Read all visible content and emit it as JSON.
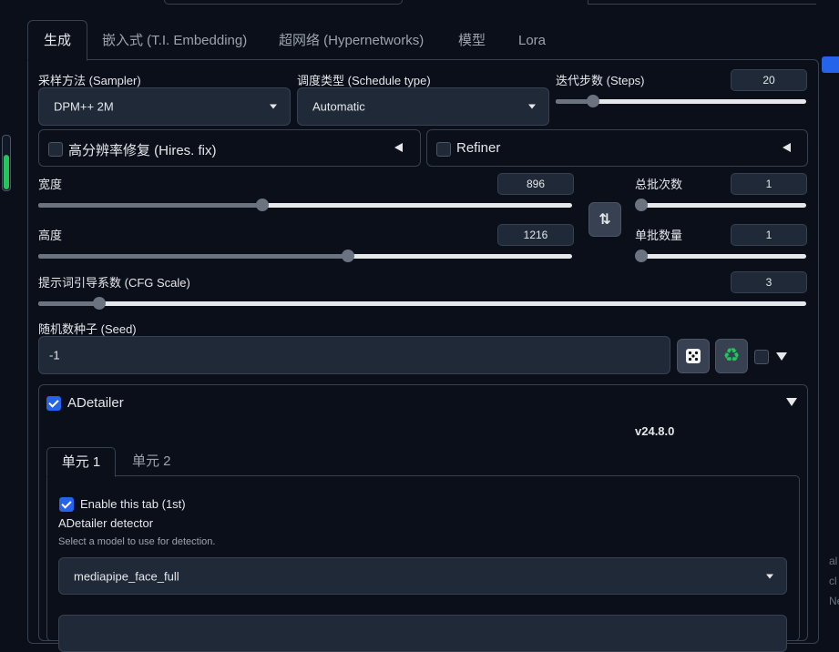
{
  "tabs": [
    "生成",
    "嵌入式 (T.I. Embedding)",
    "超网络 (Hypernetworks)",
    "模型",
    "Lora"
  ],
  "sampler": {
    "label": "采样方法 (Sampler)",
    "value": "DPM++ 2M"
  },
  "schedule": {
    "label": "调度类型 (Schedule type)",
    "value": "Automatic"
  },
  "steps": {
    "label": "迭代步数 (Steps)",
    "value": "20",
    "fraction": 0.15
  },
  "hires": {
    "label": "高分辨率修复 (Hires. fix)"
  },
  "refiner": {
    "label": "Refiner"
  },
  "width": {
    "label": "宽度",
    "value": "896",
    "fraction": 0.42
  },
  "height": {
    "label": "高度",
    "value": "1216",
    "fraction": 0.58
  },
  "batch_count": {
    "label": "总批次数",
    "value": "1",
    "fraction": 0.0
  },
  "batch_size": {
    "label": "单批数量",
    "value": "1",
    "fraction": 0.0
  },
  "cfg": {
    "label": "提示词引导系数 (CFG Scale)",
    "value": "3",
    "fraction": 0.08
  },
  "seed": {
    "label": "随机数种子 (Seed)",
    "value": "-1"
  },
  "swap_icon": "⇅",
  "dice_icon": "dice-icon",
  "recycle_icon": "♻",
  "adetailer": {
    "title": "ADetailer",
    "version": "v24.8.0",
    "tabs": [
      "单元 1",
      "单元 2"
    ],
    "enable_label": "Enable this tab (1st)",
    "detector_label": "ADetailer detector",
    "detector_hint": "Select a model to use for detection.",
    "detector_value": "mediapipe_face_full"
  },
  "side_text": [
    "al",
    "cl",
    "Ne"
  ],
  "colors": {
    "accent": "#2563eb",
    "background": "#0b0f19",
    "input": "#1f2937",
    "border": "#374151",
    "progress": "#22c55e"
  }
}
